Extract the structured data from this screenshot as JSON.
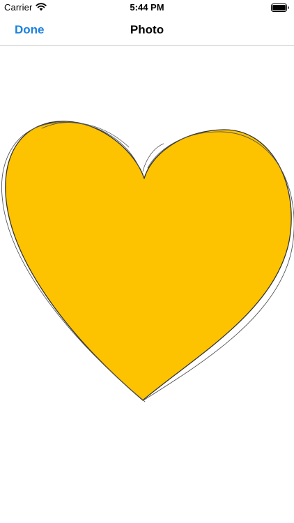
{
  "status_bar": {
    "carrier": "Carrier",
    "time": "5:44 PM",
    "wifi_icon": "wifi-icon",
    "battery_icon": "battery-full-icon"
  },
  "nav_bar": {
    "left_button_label": "Done",
    "title": "Photo",
    "accent_color": "#1a82e0"
  },
  "drawing": {
    "shape": "heart",
    "fill_color": "#fdc300",
    "stroke_color": "#333333",
    "style": "hand-sketched"
  }
}
